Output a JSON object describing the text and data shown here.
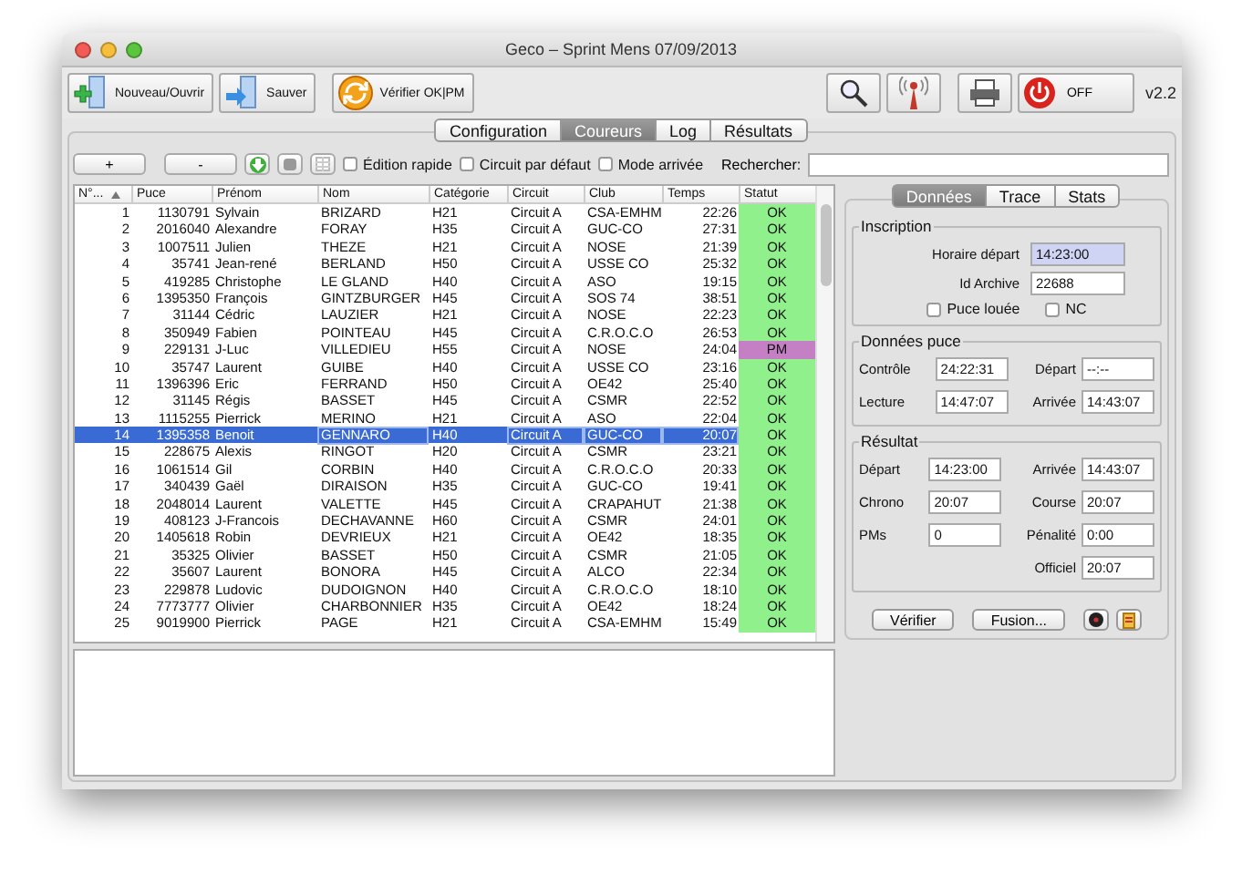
{
  "window": {
    "title": "Geco – Sprint Mens 07/09/2013"
  },
  "toolbar": {
    "buttons": [
      {
        "kind": "new",
        "label": "Nouveau/Ouvrir"
      },
      {
        "kind": "save",
        "label": "Sauver"
      },
      {
        "kind": "check",
        "label": "Vérifier OK|PM"
      }
    ],
    "power_label": "OFF",
    "version": "v2.2"
  },
  "tabs": [
    {
      "label": "Configuration",
      "selected": false
    },
    {
      "label": "Coureurs",
      "selected": true
    },
    {
      "label": "Log",
      "selected": false
    },
    {
      "label": "Résultats",
      "selected": false
    }
  ],
  "runner_toolbar": {
    "add": "+",
    "remove": "-",
    "options": [
      {
        "label": "Édition rapide",
        "checked": false
      },
      {
        "label": "Circuit par défaut",
        "checked": false
      },
      {
        "label": "Mode arrivée",
        "checked": false
      }
    ],
    "search_label": "Rechercher:"
  },
  "table": {
    "columns": [
      "N°...",
      "Puce",
      "Prénom",
      "Nom",
      "Catégorie",
      "Circuit",
      "Club",
      "Temps",
      "Statut"
    ],
    "rows": [
      {
        "num": "1",
        "chip": "1130791",
        "first": "Sylvain",
        "last": "BRIZARD",
        "cat": "H21",
        "course": "Circuit A",
        "club": "CSA-EMHM",
        "time": "22:26",
        "status": "OK",
        "color": "#90f08c",
        "selected": false
      },
      {
        "num": "2",
        "chip": "2016040",
        "first": "Alexandre",
        "last": "FORAY",
        "cat": "H35",
        "course": "Circuit A",
        "club": "GUC-CO",
        "time": "27:31",
        "status": "OK",
        "color": "#90f08c",
        "selected": false
      },
      {
        "num": "3",
        "chip": "1007511",
        "first": "Julien",
        "last": "THEZE",
        "cat": "H21",
        "course": "Circuit A",
        "club": "NOSE",
        "time": "21:39",
        "status": "OK",
        "color": "#90f08c",
        "selected": false
      },
      {
        "num": "4",
        "chip": "35741",
        "first": "Jean-rené",
        "last": "BERLAND",
        "cat": "H50",
        "course": "Circuit A",
        "club": "USSE CO",
        "time": "25:32",
        "status": "OK",
        "color": "#90f08c",
        "selected": false
      },
      {
        "num": "5",
        "chip": "419285",
        "first": "Christophe",
        "last": "LE GLAND",
        "cat": "H40",
        "course": "Circuit A",
        "club": "ASO",
        "time": "19:15",
        "status": "OK",
        "color": "#90f08c",
        "selected": false
      },
      {
        "num": "6",
        "chip": "1395350",
        "first": "François",
        "last": "GINTZBURGER",
        "cat": "H45",
        "course": "Circuit A",
        "club": "SOS 74",
        "time": "38:51",
        "status": "OK",
        "color": "#90f08c",
        "selected": false
      },
      {
        "num": "7",
        "chip": "31144",
        "first": "Cédric",
        "last": "LAUZIER",
        "cat": "H21",
        "course": "Circuit A",
        "club": "NOSE",
        "time": "22:23",
        "status": "OK",
        "color": "#90f08c",
        "selected": false
      },
      {
        "num": "8",
        "chip": "350949",
        "first": "Fabien",
        "last": "POINTEAU",
        "cat": "H45",
        "course": "Circuit A",
        "club": "C.R.O.C.O",
        "time": "26:53",
        "status": "OK",
        "color": "#90f08c",
        "selected": false
      },
      {
        "num": "9",
        "chip": "229131",
        "first": "J-Luc",
        "last": "VILLEDIEU",
        "cat": "H55",
        "course": "Circuit A",
        "club": "NOSE",
        "time": "24:04",
        "status": "PM",
        "color": "#c47fc5",
        "selected": false
      },
      {
        "num": "10",
        "chip": "35747",
        "first": "Laurent",
        "last": "GUIBE",
        "cat": "H40",
        "course": "Circuit A",
        "club": "USSE CO",
        "time": "23:16",
        "status": "OK",
        "color": "#90f08c",
        "selected": false
      },
      {
        "num": "11",
        "chip": "1396396",
        "first": "Eric",
        "last": "FERRAND",
        "cat": "H50",
        "course": "Circuit A",
        "club": "OE42",
        "time": "25:40",
        "status": "OK",
        "color": "#90f08c",
        "selected": false
      },
      {
        "num": "12",
        "chip": "31145",
        "first": "Régis",
        "last": "BASSET",
        "cat": "H45",
        "course": "Circuit A",
        "club": "CSMR",
        "time": "22:52",
        "status": "OK",
        "color": "#90f08c",
        "selected": false
      },
      {
        "num": "13",
        "chip": "1115255",
        "first": "Pierrick",
        "last": "MERINO",
        "cat": "H21",
        "course": "Circuit A",
        "club": "ASO",
        "time": "22:04",
        "status": "OK",
        "color": "#90f08c",
        "selected": false
      },
      {
        "num": "14",
        "chip": "1395358",
        "first": "Benoit",
        "last": "GENNARO",
        "cat": "H40",
        "course": "Circuit A",
        "club": "GUC-CO",
        "time": "20:07",
        "status": "OK",
        "color": "#90f08c",
        "selected": true
      },
      {
        "num": "15",
        "chip": "228675",
        "first": "Alexis",
        "last": "RINGOT",
        "cat": "H20",
        "course": "Circuit A",
        "club": "CSMR",
        "time": "23:21",
        "status": "OK",
        "color": "#90f08c",
        "selected": false
      },
      {
        "num": "16",
        "chip": "1061514",
        "first": "Gil",
        "last": "CORBIN",
        "cat": "H40",
        "course": "Circuit A",
        "club": "C.R.O.C.O",
        "time": "20:33",
        "status": "OK",
        "color": "#90f08c",
        "selected": false
      },
      {
        "num": "17",
        "chip": "340439",
        "first": "Gaël",
        "last": "DIRAISON",
        "cat": "H35",
        "course": "Circuit A",
        "club": "GUC-CO",
        "time": "19:41",
        "status": "OK",
        "color": "#90f08c",
        "selected": false
      },
      {
        "num": "18",
        "chip": "2048014",
        "first": "Laurent",
        "last": "VALETTE",
        "cat": "H45",
        "course": "Circuit A",
        "club": "CRAPAHUT",
        "time": "21:38",
        "status": "OK",
        "color": "#90f08c",
        "selected": false
      },
      {
        "num": "19",
        "chip": "408123",
        "first": "J-Francois",
        "last": "DECHAVANNE",
        "cat": "H60",
        "course": "Circuit A",
        "club": "CSMR",
        "time": "24:01",
        "status": "OK",
        "color": "#90f08c",
        "selected": false
      },
      {
        "num": "20",
        "chip": "1405618",
        "first": "Robin",
        "last": "DEVRIEUX",
        "cat": "H21",
        "course": "Circuit A",
        "club": "OE42",
        "time": "18:35",
        "status": "OK",
        "color": "#90f08c",
        "selected": false
      },
      {
        "num": "21",
        "chip": "35325",
        "first": "Olivier",
        "last": "BASSET",
        "cat": "H50",
        "course": "Circuit A",
        "club": "CSMR",
        "time": "21:05",
        "status": "OK",
        "color": "#90f08c",
        "selected": false
      },
      {
        "num": "22",
        "chip": "35607",
        "first": "Laurent",
        "last": "BONORA",
        "cat": "H45",
        "course": "Circuit A",
        "club": "ALCO",
        "time": "22:34",
        "status": "OK",
        "color": "#90f08c",
        "selected": false
      },
      {
        "num": "23",
        "chip": "229878",
        "first": "Ludovic",
        "last": "DUDOIGNON",
        "cat": "H40",
        "course": "Circuit A",
        "club": "C.R.O.C.O",
        "time": "18:10",
        "status": "OK",
        "color": "#90f08c",
        "selected": false
      },
      {
        "num": "24",
        "chip": "7773777",
        "first": "Olivier",
        "last": "CHARBONNIER",
        "cat": "H35",
        "course": "Circuit A",
        "club": "OE42",
        "time": "18:24",
        "status": "OK",
        "color": "#90f08c",
        "selected": false
      },
      {
        "num": "25",
        "chip": "9019900",
        "first": "Pierrick",
        "last": "PAGE",
        "cat": "H21",
        "course": "Circuit A",
        "club": "CSA-EMHM",
        "time": "15:49",
        "status": "OK",
        "color": "#90f08c",
        "selected": false
      }
    ]
  },
  "details": {
    "tabs": [
      {
        "label": "Données",
        "selected": true
      },
      {
        "label": "Trace",
        "selected": false
      },
      {
        "label": "Stats",
        "selected": false
      }
    ],
    "inscription": {
      "title": "Inscription",
      "fields": [
        {
          "label": "Horaire départ",
          "value": "14:23:00",
          "highlighted": true
        },
        {
          "label": "Id Archive",
          "value": "22688",
          "highlighted": false
        }
      ],
      "options": [
        {
          "label": "Puce louée",
          "checked": false
        },
        {
          "label": "NC",
          "checked": false
        }
      ]
    },
    "chip": {
      "title": "Données puce",
      "fields": [
        {
          "label": "Contrôle",
          "value": "24:22:31"
        },
        {
          "label": "Départ",
          "value": "--:--"
        },
        {
          "label": "Lecture",
          "value": "14:47:07"
        },
        {
          "label": "Arrivée",
          "value": "14:43:07"
        }
      ]
    },
    "result": {
      "title": "Résultat",
      "fields": [
        {
          "label": "Départ",
          "value": "14:23:00"
        },
        {
          "label": "Arrivée",
          "value": "14:43:07"
        },
        {
          "label": "Chrono",
          "value": "20:07"
        },
        {
          "label": "Course",
          "value": "20:07"
        },
        {
          "label": "PMs",
          "value": "0"
        },
        {
          "label": "Pénalité",
          "value": "0:00"
        },
        {
          "label": "Officiel",
          "value": "20:07"
        }
      ]
    },
    "buttons": [
      "Vérifier",
      "Fusion..."
    ]
  }
}
